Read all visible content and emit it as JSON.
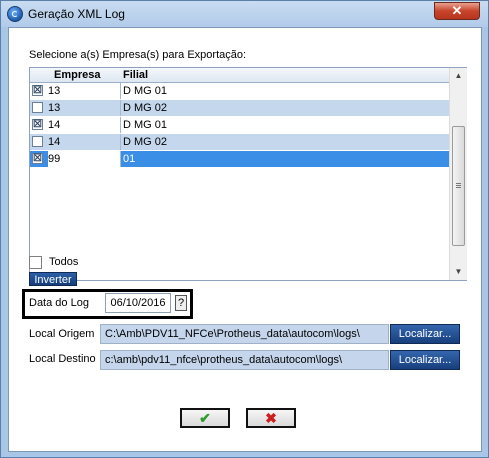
{
  "window": {
    "title": "Geração XML Log",
    "close_glyph": "✕",
    "app_icon": "app-logo-icon"
  },
  "main": {
    "select_label": "Selecione a(s) Empresa(s) para Exportação:",
    "columns": [
      "Empresa",
      "Filial"
    ],
    "rows": [
      {
        "checked": true,
        "empresa": "13",
        "filial": "D MG 01",
        "checkmark": "☒"
      },
      {
        "checked": false,
        "empresa": "13",
        "filial": "D MG 02",
        "checkmark": ""
      },
      {
        "checked": true,
        "empresa": "14",
        "filial": "D MG 01",
        "checkmark": "☒"
      },
      {
        "checked": false,
        "empresa": "14",
        "filial": "D MG 02",
        "checkmark": ""
      },
      {
        "checked": true,
        "empresa": "99",
        "filial": "01",
        "checkmark": "☒",
        "selected": true
      }
    ],
    "todos_label": "Todos",
    "todos_checked": false,
    "inverter_label": "Inverter",
    "data_log_label": "Data do Log",
    "data_log_value": "06/10/2016",
    "help_glyph": "?",
    "local_origem_label": "Local Origem",
    "local_origem_value": "C:\\Amb\\PDV11_NFCe\\Protheus_data\\autocom\\logs\\",
    "local_destino_label": "Local Destino",
    "local_destino_value": "c:\\amb\\pdv11_nfce\\protheus_data\\autocom\\logs\\",
    "localizar_label": "Localizar...",
    "ok_glyph": "✔",
    "cancel_glyph": "✖"
  }
}
